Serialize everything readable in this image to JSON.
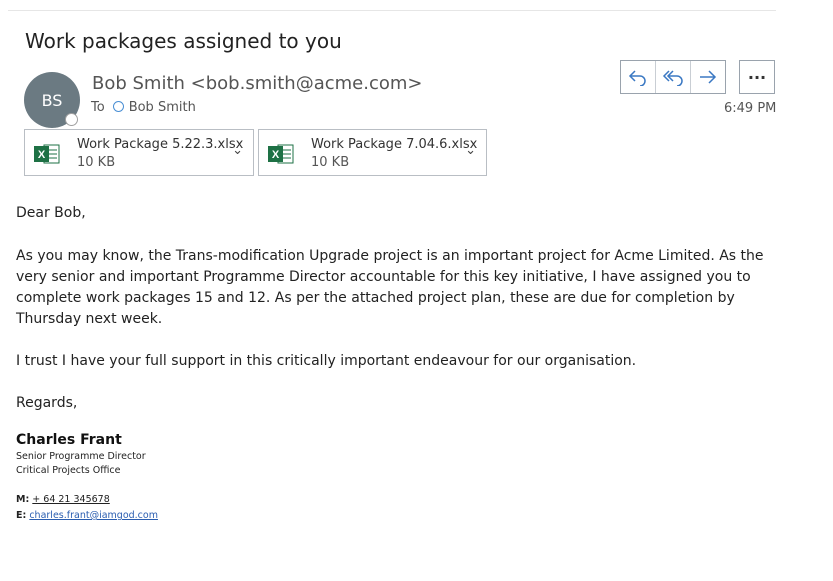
{
  "email": {
    "subject": "Work packages assigned to you",
    "avatar_initials": "BS",
    "sender": "Bob Smith <bob.smith@acme.com>",
    "to_label": "To",
    "to_name": "Bob Smith",
    "time": "6:49 PM"
  },
  "actions": {
    "reply_icon": "reply-icon",
    "reply_all_icon": "reply-all-icon",
    "forward_icon": "forward-icon",
    "more_label": "···"
  },
  "attachments": [
    {
      "name": "Work Package 5.22.3.xlsx",
      "size": "10 KB",
      "icon": "excel-icon"
    },
    {
      "name": "Work Package 7.04.6.xlsx",
      "size": "10 KB",
      "icon": "excel-icon"
    }
  ],
  "body": {
    "greeting": "Dear Bob,",
    "paragraph1": "As you may know, the Trans-modification Upgrade project is an important project for Acme Limited. As the very senior and important Programme Director accountable for this key initiative, I have assigned you to complete work packages 15 and 12. As per the attached project plan, these are due for completion by Thursday next week.",
    "paragraph2": "I trust I have your full support in this critically important endeavour for our organisation.",
    "closing": "Regards,"
  },
  "signature": {
    "name": "Charles Frant",
    "title": "Senior Programme Director",
    "office": "Critical Projects Office",
    "mobile_label": "M:",
    "mobile": "+ 64 21 345678",
    "email_label": "E:",
    "email": "charles.frant@iamgod.com"
  },
  "colors": {
    "accent": "#3a78c3",
    "avatar_bg": "#6b7a82",
    "excel_green": "#1e7145"
  }
}
